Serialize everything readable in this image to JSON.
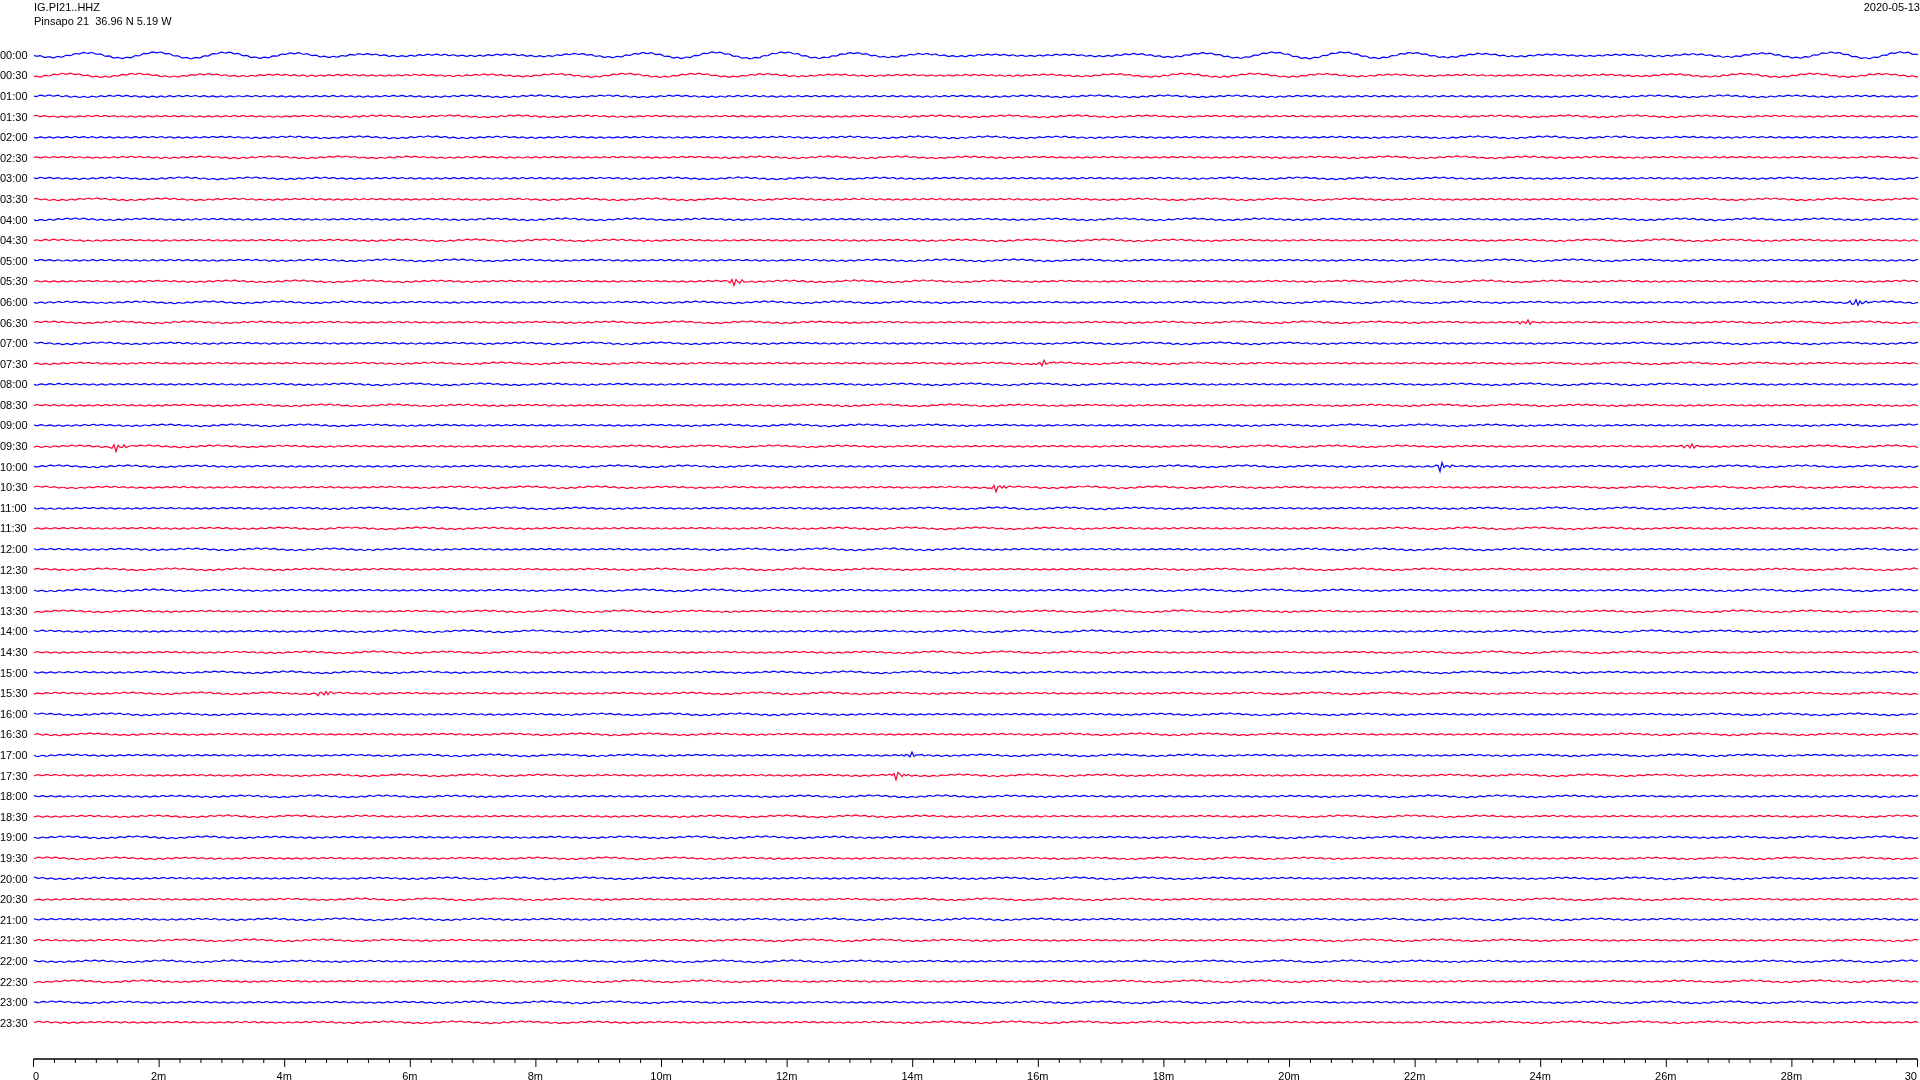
{
  "header": {
    "station_code": "IG.PI21..HHZ",
    "station_info": "Pinsapo 21  36.96 N 5.19 W",
    "date": "2020-05-13"
  },
  "rows": [
    {
      "time": "00:00",
      "color": "#0000ff"
    },
    {
      "time": "00:30",
      "color": "#ff0033"
    },
    {
      "time": "01:00",
      "color": "#0000ff"
    },
    {
      "time": "01:30",
      "color": "#ff0033"
    },
    {
      "time": "02:00",
      "color": "#0000ff"
    },
    {
      "time": "02:30",
      "color": "#ff0033"
    },
    {
      "time": "03:00",
      "color": "#0000ff"
    },
    {
      "time": "03:30",
      "color": "#ff0033"
    },
    {
      "time": "04:00",
      "color": "#0000ff"
    },
    {
      "time": "04:30",
      "color": "#ff0033"
    },
    {
      "time": "05:00",
      "color": "#0000ff"
    },
    {
      "time": "05:30",
      "color": "#ff0033"
    },
    {
      "time": "06:00",
      "color": "#0000ff"
    },
    {
      "time": "06:30",
      "color": "#ff0033"
    },
    {
      "time": "07:00",
      "color": "#0000ff"
    },
    {
      "time": "07:30",
      "color": "#ff0033"
    },
    {
      "time": "08:00",
      "color": "#0000ff"
    },
    {
      "time": "08:30",
      "color": "#ff0033"
    },
    {
      "time": "09:00",
      "color": "#0000ff"
    },
    {
      "time": "09:30",
      "color": "#ff0033"
    },
    {
      "time": "10:00",
      "color": "#0000ff"
    },
    {
      "time": "10:30",
      "color": "#ff0033"
    },
    {
      "time": "11:00",
      "color": "#0000ff"
    },
    {
      "time": "11:30",
      "color": "#ff0033"
    },
    {
      "time": "12:00",
      "color": "#0000ff"
    },
    {
      "time": "12:30",
      "color": "#ff0033"
    },
    {
      "time": "13:00",
      "color": "#0000ff"
    },
    {
      "time": "13:30",
      "color": "#ff0033"
    },
    {
      "time": "14:00",
      "color": "#0000ff"
    },
    {
      "time": "14:30",
      "color": "#ff0033"
    },
    {
      "time": "15:00",
      "color": "#0000ff"
    },
    {
      "time": "15:30",
      "color": "#ff0033"
    },
    {
      "time": "16:00",
      "color": "#0000ff"
    },
    {
      "time": "16:30",
      "color": "#ff0033"
    },
    {
      "time": "17:00",
      "color": "#0000ff"
    },
    {
      "time": "17:30",
      "color": "#ff0033"
    },
    {
      "time": "18:00",
      "color": "#0000ff"
    },
    {
      "time": "18:30",
      "color": "#ff0033"
    },
    {
      "time": "19:00",
      "color": "#0000ff"
    },
    {
      "time": "19:30",
      "color": "#ff0033"
    },
    {
      "time": "20:00",
      "color": "#0000ff"
    },
    {
      "time": "20:30",
      "color": "#ff0033"
    },
    {
      "time": "21:00",
      "color": "#0000ff"
    },
    {
      "time": "21:30",
      "color": "#ff0033"
    },
    {
      "time": "22:00",
      "color": "#0000ff"
    },
    {
      "time": "22:30",
      "color": "#ff0033"
    },
    {
      "time": "23:00",
      "color": "#0000ff"
    },
    {
      "time": "23:30",
      "color": "#ff0033"
    }
  ],
  "x_axis": {
    "tick_labels": [
      "0",
      "2m",
      "4m",
      "6m",
      "8m",
      "10m",
      "12m",
      "14m",
      "16m",
      "18m",
      "20m",
      "22m",
      "24m",
      "26m",
      "28m",
      "30"
    ]
  }
}
